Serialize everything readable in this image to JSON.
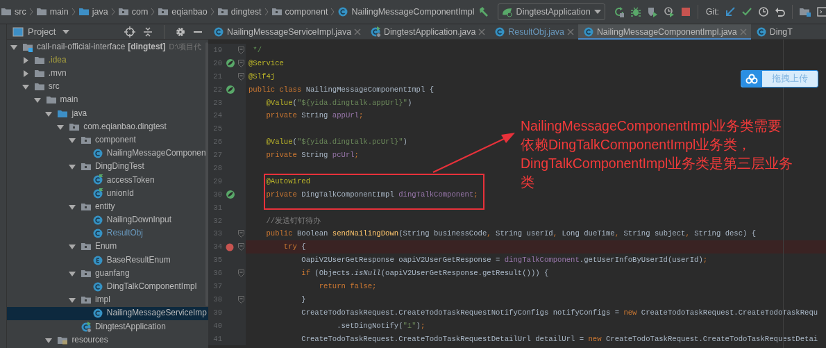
{
  "breadcrumbs": [
    {
      "label": "src",
      "kind": "folder"
    },
    {
      "label": "main",
      "kind": "folder"
    },
    {
      "label": "java",
      "kind": "source-folder"
    },
    {
      "label": "com",
      "kind": "package"
    },
    {
      "label": "eqianbao",
      "kind": "package"
    },
    {
      "label": "dingtest",
      "kind": "package"
    },
    {
      "label": "component",
      "kind": "package"
    },
    {
      "label": "NailingMessageComponentImpl",
      "kind": "class"
    }
  ],
  "toolbar": {
    "run_config": "DingtestApplication",
    "git_label": "Git:"
  },
  "project_panel": {
    "title": "Project"
  },
  "tree": [
    {
      "label": "call-nail-official-interface",
      "module": "[dingtest]",
      "path": "D:\\项目代",
      "kind": "module",
      "expanded": true,
      "selected": false,
      "ignored": false,
      "modified": false,
      "children": [
        {
          "label": ".idea",
          "kind": "folder",
          "expanded": false,
          "selected": false,
          "ignored": true,
          "modified": false
        },
        {
          "label": ".mvn",
          "kind": "folder",
          "expanded": false,
          "selected": false,
          "ignored": false,
          "modified": false
        },
        {
          "label": "src",
          "kind": "folder",
          "expanded": true,
          "selected": false,
          "ignored": false,
          "modified": false,
          "children": [
            {
              "label": "main",
              "kind": "folder",
              "expanded": true,
              "selected": false,
              "ignored": false,
              "modified": false,
              "children": [
                {
                  "label": "java",
                  "kind": "source-folder",
                  "expanded": true,
                  "selected": false,
                  "ignored": false,
                  "modified": false,
                  "children": [
                    {
                      "label": "com.eqianbao.dingtest",
                      "kind": "package",
                      "expanded": true,
                      "selected": false,
                      "ignored": false,
                      "modified": false,
                      "children": [
                        {
                          "label": "component",
                          "kind": "package",
                          "expanded": true,
                          "selected": false,
                          "ignored": false,
                          "modified": false,
                          "children": [
                            {
                              "label": "NailingMessageComponen",
                              "kind": "class",
                              "selected": false,
                              "ignored": false,
                              "modified": false
                            }
                          ]
                        },
                        {
                          "label": "DingDingTest",
                          "kind": "package",
                          "expanded": true,
                          "selected": false,
                          "ignored": false,
                          "modified": false,
                          "children": [
                            {
                              "label": "accessToken",
                              "kind": "runnable-class",
                              "selected": false,
                              "ignored": false,
                              "modified": false
                            },
                            {
                              "label": "unionId",
                              "kind": "runnable-class",
                              "selected": false,
                              "ignored": false,
                              "modified": false
                            }
                          ]
                        },
                        {
                          "label": "entity",
                          "kind": "package",
                          "expanded": true,
                          "selected": false,
                          "ignored": false,
                          "modified": false,
                          "children": [
                            {
                              "label": "NailingDownInput",
                              "kind": "class",
                              "selected": false,
                              "ignored": false,
                              "modified": false
                            },
                            {
                              "label": "ResultObj",
                              "kind": "class",
                              "selected": false,
                              "ignored": false,
                              "modified": true
                            }
                          ]
                        },
                        {
                          "label": "Enum",
                          "kind": "package",
                          "expanded": true,
                          "selected": false,
                          "ignored": false,
                          "modified": false,
                          "children": [
                            {
                              "label": "BaseResultEnum",
                              "kind": "enum",
                              "selected": false,
                              "ignored": false,
                              "modified": false
                            }
                          ]
                        },
                        {
                          "label": "guanfang",
                          "kind": "package",
                          "expanded": true,
                          "selected": false,
                          "ignored": false,
                          "modified": false,
                          "children": [
                            {
                              "label": "DingTalkComponentImpl",
                              "kind": "class",
                              "selected": false,
                              "ignored": false,
                              "modified": false
                            }
                          ]
                        },
                        {
                          "label": "impl",
                          "kind": "package",
                          "expanded": true,
                          "selected": false,
                          "ignored": false,
                          "modified": false,
                          "children": [
                            {
                              "label": "NailingMessageServiceImp",
                              "kind": "class",
                              "selected": true,
                              "ignored": false,
                              "modified": false
                            }
                          ]
                        },
                        {
                          "label": "DingtestApplication",
                          "kind": "application",
                          "selected": false,
                          "ignored": false,
                          "modified": false
                        }
                      ]
                    }
                  ]
                },
                {
                  "label": "resources",
                  "kind": "resources",
                  "expanded": true,
                  "selected": false,
                  "ignored": false,
                  "modified": false
                }
              ]
            }
          ]
        }
      ]
    }
  ],
  "tabs": [
    {
      "label": "NailingMessageServiceImpl.java",
      "kind": "class",
      "selected": false,
      "modified": false
    },
    {
      "label": "DingtestApplication.java",
      "kind": "application",
      "selected": false,
      "modified": false
    },
    {
      "label": "ResultObj.java",
      "kind": "class",
      "selected": false,
      "modified": true
    },
    {
      "label": "NailingMessageComponentImpl.java",
      "kind": "class",
      "selected": true,
      "modified": false
    },
    {
      "label": "DingT",
      "kind": "class",
      "selected": false,
      "modified": false
    }
  ],
  "editor": {
    "lines": [
      {
        "number": "19",
        "kind": "plain",
        "fold": true,
        "tokens": [
          {
            "text": " */",
            "kind": "doc"
          }
        ]
      },
      {
        "number": "20",
        "kind": "bean",
        "fold": true,
        "tokens": [
          {
            "text": "@Service",
            "kind": "annotation"
          }
        ]
      },
      {
        "number": "21",
        "kind": "plain",
        "fold": true,
        "tokens": [
          {
            "text": "@Slf4j",
            "kind": "annotation"
          }
        ]
      },
      {
        "number": "22",
        "kind": "bean",
        "fold": false,
        "tokens": [
          {
            "text": "public class ",
            "kind": "keyword"
          },
          {
            "text": "NailingMessageComponentImpl {",
            "kind": "plain"
          }
        ]
      },
      {
        "number": "23",
        "kind": "plain",
        "fold": false,
        "tokens": [
          {
            "text": "    @Value",
            "kind": "annotation"
          },
          {
            "text": "(",
            "kind": "plain"
          },
          {
            "text": "\"${yida.dingtalk.appUrl}\"",
            "kind": "string"
          },
          {
            "text": ")",
            "kind": "plain"
          }
        ]
      },
      {
        "number": "24",
        "kind": "plain",
        "fold": false,
        "tokens": [
          {
            "text": "    private ",
            "kind": "keyword"
          },
          {
            "text": "String ",
            "kind": "plain"
          },
          {
            "text": "appUrl",
            "kind": "field"
          },
          {
            "text": ";",
            "kind": "keyword"
          }
        ]
      },
      {
        "number": "25",
        "kind": "plain",
        "fold": false
      },
      {
        "number": "26",
        "kind": "plain",
        "fold": false,
        "tokens": [
          {
            "text": "    @Value",
            "kind": "annotation"
          },
          {
            "text": "(",
            "kind": "plain"
          },
          {
            "text": "\"${yida.dingtalk.pcUrl}\"",
            "kind": "string"
          },
          {
            "text": ")",
            "kind": "plain"
          }
        ]
      },
      {
        "number": "27",
        "kind": "plain",
        "fold": false,
        "tokens": [
          {
            "text": "    private ",
            "kind": "keyword"
          },
          {
            "text": "String ",
            "kind": "plain"
          },
          {
            "text": "pcUrl",
            "kind": "field"
          },
          {
            "text": ";",
            "kind": "keyword"
          }
        ]
      },
      {
        "number": "28",
        "kind": "plain",
        "fold": false
      },
      {
        "number": "29",
        "kind": "plain",
        "fold": false,
        "tokens": [
          {
            "text": "    @Autowired",
            "kind": "annotation"
          }
        ]
      },
      {
        "number": "30",
        "kind": "bean",
        "fold": false,
        "tokens": [
          {
            "text": "    private ",
            "kind": "keyword"
          },
          {
            "text": "DingTalkComponentImpl ",
            "kind": "plain"
          },
          {
            "text": "dingTalkComponent",
            "kind": "field"
          },
          {
            "text": ";",
            "kind": "keyword"
          }
        ]
      },
      {
        "number": "31",
        "kind": "plain",
        "fold": false
      },
      {
        "number": "32",
        "kind": "plain",
        "fold": false,
        "tokens": [
          {
            "text": "    //发送钉钉待办",
            "kind": "comment"
          }
        ]
      },
      {
        "number": "33",
        "kind": "plain",
        "fold": true,
        "tokens": [
          {
            "text": "    public ",
            "kind": "keyword"
          },
          {
            "text": "Boolean ",
            "kind": "plain"
          },
          {
            "text": "sendNailingDown",
            "kind": "method"
          },
          {
            "text": "(String businessCode",
            "kind": "plain"
          },
          {
            "text": ", ",
            "kind": "keyword"
          },
          {
            "text": "String userId",
            "kind": "plain"
          },
          {
            "text": ", ",
            "kind": "keyword"
          },
          {
            "text": "Long dueTime",
            "kind": "plain"
          },
          {
            "text": ", ",
            "kind": "keyword"
          },
          {
            "text": "String subject",
            "kind": "plain"
          },
          {
            "text": ", ",
            "kind": "keyword"
          },
          {
            "text": "String desc) {",
            "kind": "plain"
          }
        ]
      },
      {
        "number": "34",
        "kind": "breakpoint",
        "fold": true,
        "tokens": [
          {
            "text": "        try",
            "kind": "keyword"
          },
          {
            "text": " {",
            "kind": "plain"
          }
        ]
      },
      {
        "number": "35",
        "kind": "plain",
        "fold": false,
        "tokens": [
          {
            "text": "            OapiV2UserGetResponse oapiV2UserGetResponse = ",
            "kind": "plain"
          },
          {
            "text": "dingTalkComponent",
            "kind": "field"
          },
          {
            "text": ".getUserInfoByUserId(userId)",
            "kind": "plain"
          },
          {
            "text": ";",
            "kind": "keyword"
          }
        ]
      },
      {
        "number": "36",
        "kind": "plain",
        "fold": true,
        "tokens": [
          {
            "text": "            if ",
            "kind": "keyword"
          },
          {
            "text": "(Objects.",
            "kind": "plain"
          },
          {
            "text": "isNull",
            "kind": "static"
          },
          {
            "text": "(oapiV2UserGetResponse.getResult())) {",
            "kind": "plain"
          }
        ]
      },
      {
        "number": "37",
        "kind": "plain",
        "fold": false,
        "tokens": [
          {
            "text": "                return false;",
            "kind": "keyword"
          }
        ]
      },
      {
        "number": "38",
        "kind": "plain",
        "fold": true,
        "tokens": [
          {
            "text": "            }",
            "kind": "plain"
          }
        ]
      },
      {
        "number": "39",
        "kind": "plain",
        "fold": false,
        "tokens": [
          {
            "text": "            CreateTodoTaskRequest.CreateTodoTaskRequestNotifyConfigs notifyConfigs = ",
            "kind": "plain"
          },
          {
            "text": "new ",
            "kind": "keyword"
          },
          {
            "text": "CreateTodoTaskRequest.CreateTodoTaskRequ",
            "kind": "plain"
          }
        ]
      },
      {
        "number": "40",
        "kind": "plain",
        "fold": false,
        "tokens": [
          {
            "text": "                    .setDingNotify(",
            "kind": "plain"
          },
          {
            "text": "\"1\"",
            "kind": "string"
          },
          {
            "text": ")",
            "kind": "plain"
          },
          {
            "text": ";",
            "kind": "keyword"
          }
        ]
      },
      {
        "number": "41",
        "kind": "plain",
        "fold": false,
        "tokens": [
          {
            "text": "            CreateTodoTaskRequest.CreateTodoTaskRequestDetailUrl detailUrl = ",
            "kind": "plain"
          },
          {
            "text": "new ",
            "kind": "keyword"
          },
          {
            "text": "CreateTodoTaskRequest.CreateTodoTaskRequestDetai",
            "kind": "plain"
          }
        ]
      }
    ]
  },
  "annotation": {
    "note_lines": [
      "NailingMessageComponentImpl业务类需要",
      "依赖DingTalkComponentImpl业务类，",
      "DingTalkComponentImpl业务类是第三层业务",
      "类"
    ]
  },
  "upload_button": {
    "label": "拖拽上传"
  }
}
